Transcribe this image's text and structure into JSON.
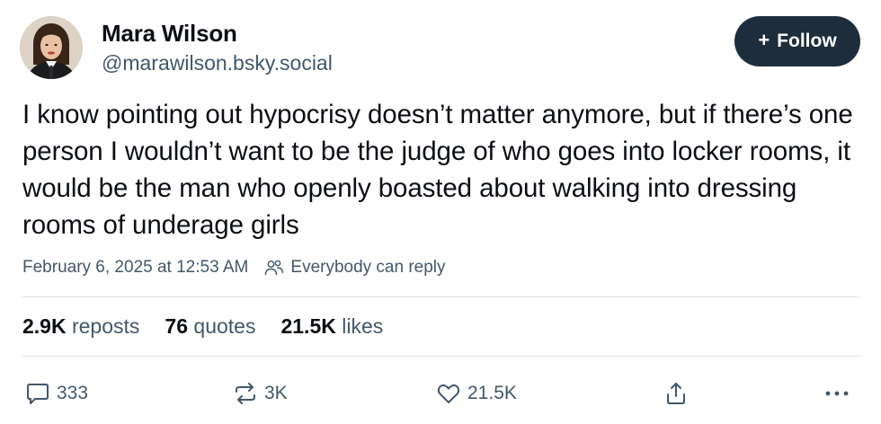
{
  "author": {
    "display_name": "Mara Wilson",
    "handle": "@marawilson.bsky.social"
  },
  "follow_button": {
    "icon": "plus-icon",
    "label": "Follow"
  },
  "post": {
    "text": "I know pointing out hypocrisy doesn’t matter anymore, but if there’s one person I wouldn’t want to be the judge of who goes into locker rooms, it would be the man who openly boasted about walking into dressing rooms of underage girls",
    "timestamp": "February 6, 2025 at 12:53 AM",
    "reply_setting": "Everybody can reply"
  },
  "stats": {
    "reposts_count": "2.9K",
    "reposts_label": "reposts",
    "quotes_count": "76",
    "quotes_label": "quotes",
    "likes_count": "21.5K",
    "likes_label": "likes"
  },
  "actions": {
    "reply_count": "333",
    "repost_count": "3K",
    "like_count": "21.5K"
  },
  "colors": {
    "text": "#0b0f14",
    "muted": "#42576c",
    "follow_bg": "#1e2d3c",
    "divider": "#dfe4ea"
  }
}
